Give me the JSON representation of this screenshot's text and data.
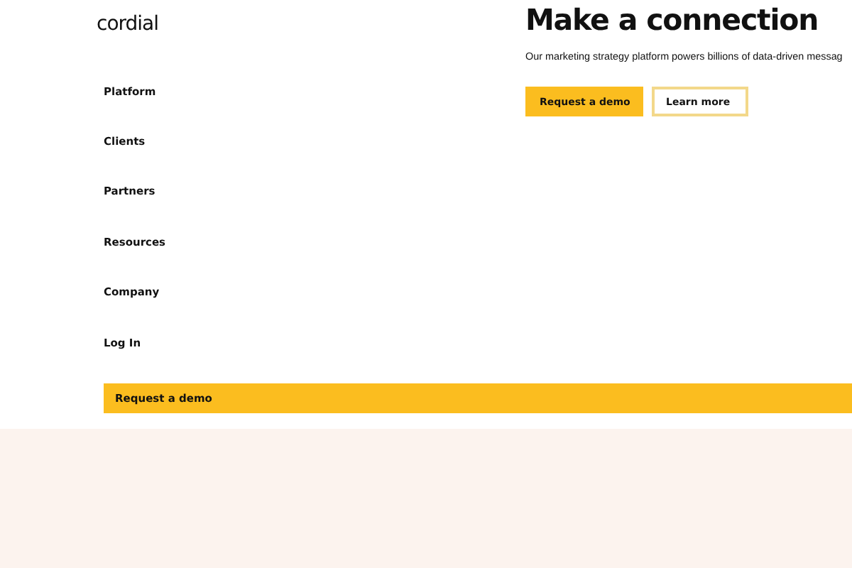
{
  "logo": "cordial",
  "nav": {
    "items": [
      "Platform",
      "Clients",
      "Partners",
      "Resources",
      "Company",
      "Log In"
    ],
    "cta": "Request a demo"
  },
  "hero": {
    "title": "Make a connection",
    "subtitle": "Our marketing strategy platform powers billions of data-driven messag",
    "buttons": [
      {
        "label": "Request a demo",
        "kind": "primary"
      },
      {
        "label": "Learn more",
        "kind": "secondary"
      }
    ]
  }
}
